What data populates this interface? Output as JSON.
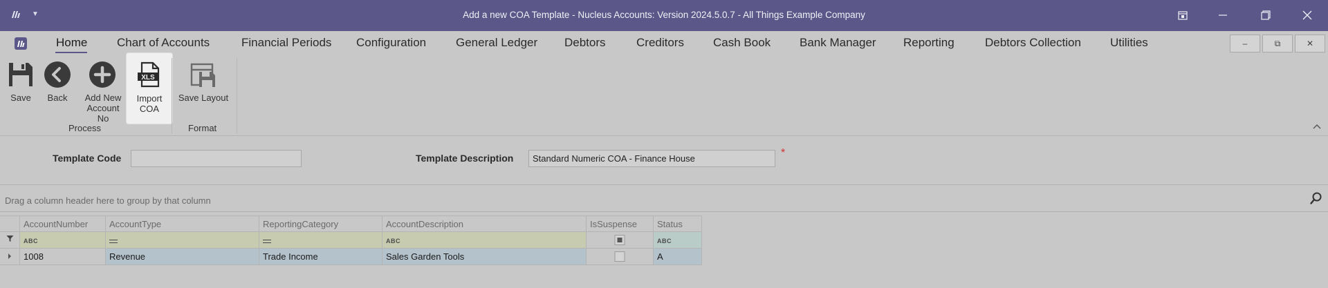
{
  "window": {
    "title": "Add a new COA Template - Nucleus Accounts: Version 2024.5.0.7 - All Things Example Company",
    "app_icon": "nucleus-app-icon",
    "dropdown_icon": "caret-down-icon",
    "controls": [
      "restore-layout-icon",
      "minimize-icon",
      "maximize-icon",
      "close-icon"
    ]
  },
  "menu": {
    "items": [
      "Home",
      "Chart of Accounts",
      "Financial Periods",
      "Configuration",
      "General Ledger",
      "Debtors",
      "Creditors",
      "Cash Book",
      "Bank Manager",
      "Reporting",
      "Debtors Collection",
      "Utilities"
    ],
    "active": "Home",
    "mdi_controls": [
      "–",
      "⧉",
      "✕"
    ]
  },
  "ribbon": {
    "buttons": [
      {
        "label": "Save",
        "icon": "save-icon"
      },
      {
        "label": "Back",
        "icon": "back-arrow-icon"
      },
      {
        "label": "Add New Account No",
        "icon": "add-icon"
      },
      {
        "label": "Import COA",
        "icon": "xls-file-icon"
      },
      {
        "label": "Save Layout",
        "icon": "save-layout-icon"
      }
    ],
    "groups": [
      "Process",
      "Format"
    ],
    "xls_badge": "XLS"
  },
  "form": {
    "template_code_label": "Template Code",
    "template_code_value": "",
    "template_description_label": "Template Description",
    "template_description_value": "Standard Numeric COA - Finance House",
    "required_marker": "*"
  },
  "grid": {
    "group_hint": "Drag a column header here to group by that column",
    "columns": [
      "AccountNumber",
      "AccountType",
      "ReportingCategory",
      "AccountDescription",
      "IsSuspense",
      "Status"
    ],
    "filter_glyph": "ABC",
    "rows": [
      {
        "AccountNumber": "1008",
        "AccountType": "Revenue",
        "ReportingCategory": "Trade Income",
        "AccountDescription": "Sales Garden Tools",
        "IsSuspense": false,
        "Status": "A"
      }
    ]
  },
  "colors": {
    "title_bar": "#5b5789",
    "background": "#c8c8c8",
    "filter_row": "#c7cbb0",
    "selected_cell": "#b4c2cc",
    "required": "#d23030"
  }
}
